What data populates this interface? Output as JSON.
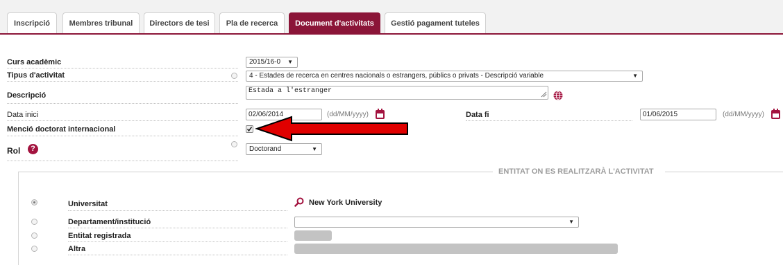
{
  "tabs": [
    {
      "label": "Inscripció",
      "active": false
    },
    {
      "label": "Membres tribunal",
      "active": false
    },
    {
      "label": "Directors de tesi",
      "active": false
    },
    {
      "label": "Pla de recerca",
      "active": false
    },
    {
      "label": "Document d'activitats",
      "active": true
    },
    {
      "label": "Gestió pagament tuteles",
      "active": false
    }
  ],
  "form": {
    "curs_label": "Curs acadèmic",
    "curs_value": "2015/16-0",
    "tipus_label": "Tipus d'activitat",
    "tipus_value": "4 - Estades de recerca en centres nacionals o estrangers, públics o privats - Descripció variable",
    "descripcio_label": "Descripció",
    "descripcio_value": "Estada a l'estranger",
    "data_inici_label": "Data inici",
    "data_inici_value": "02/06/2014",
    "date_format_hint": "(dd/MM/yyyy)",
    "data_fi_label": "Data fi",
    "data_fi_value": "01/06/2015",
    "mencio_label": "Menció doctorat internacional",
    "mencio_checked": true,
    "rol_label": "Rol",
    "rol_value": "Doctorand"
  },
  "entitat": {
    "section_title": "ENTITAT ON ES REALITZARÀ L'ACTIVITAT",
    "options": [
      {
        "label": "Universitat",
        "selected": true
      },
      {
        "label": "Departament/institució",
        "selected": false
      },
      {
        "label": "Entitat registrada",
        "selected": false
      },
      {
        "label": "Altra",
        "selected": false
      }
    ],
    "universitat_value": "New York University"
  },
  "colors": {
    "accent": "#8b1538",
    "arrow": "#e00000"
  },
  "icons": [
    "calendar-icon",
    "globe-icon",
    "help-icon",
    "search-icon",
    "dropdown-arrow-icon"
  ]
}
